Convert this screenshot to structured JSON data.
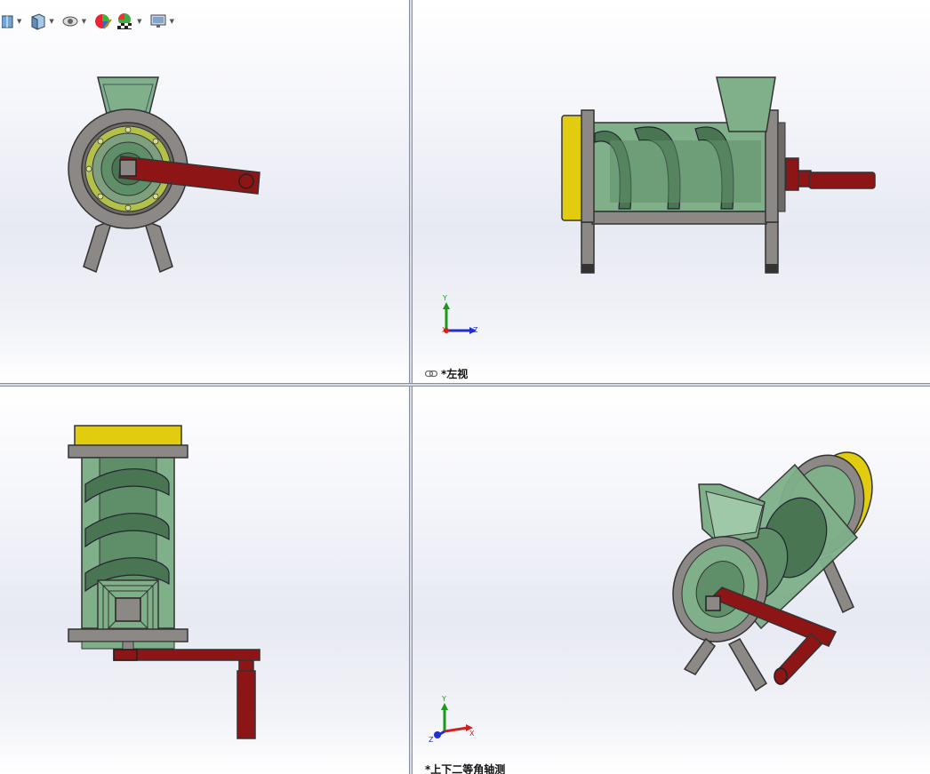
{
  "toolbar": {
    "items": [
      {
        "icon": "section-view-icon"
      },
      {
        "icon": "view-orientation-icon"
      },
      {
        "icon": "hide-show-icon"
      },
      {
        "icon": "edit-appearance-icon"
      },
      {
        "icon": "apply-scene-icon"
      },
      {
        "icon": "view-settings-icon"
      }
    ]
  },
  "views": {
    "top_right": {
      "label": "*左视"
    },
    "bottom_right": {
      "label": "*上下二等角轴测"
    }
  },
  "triad": {
    "top_right": {
      "y": "Y",
      "z": "Z",
      "x": "X"
    },
    "bottom_right": {
      "y": "Y",
      "z": "Z",
      "x": "X"
    }
  },
  "colors": {
    "handle_red": "#8e1515",
    "hopper_green": "#7fb08a",
    "body_green": "#5e8f68",
    "frame_gray": "#8c8886",
    "end_cap_yellow": "#e1cc10",
    "triad_y": "#1a9a1a",
    "triad_z": "#2030d0",
    "triad_x": "#d02020"
  }
}
